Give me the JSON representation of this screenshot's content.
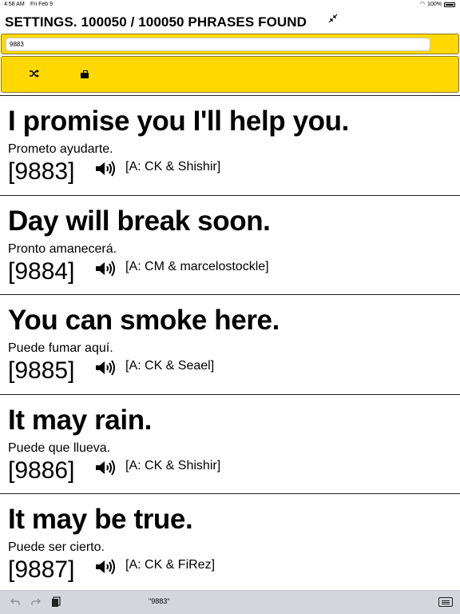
{
  "status": {
    "time": "4:58 AM",
    "date": "Fri Feb 9",
    "battery": "100%"
  },
  "header": {
    "title": "SETTINGS. 100050 / 100050 PHRASES FOUND"
  },
  "search": {
    "value": "9883"
  },
  "phrases": [
    {
      "en": "I promise you I'll help you.",
      "es": "Prometo ayudarte.",
      "id": "[9883]",
      "attrib": "[A: CK & Shishir]"
    },
    {
      "en": "Day will break soon.",
      "es": "Pronto amanecerá.",
      "id": "[9884]",
      "attrib": "[A: CM & marcelostockle]"
    },
    {
      "en": "You can smoke here.",
      "es": "Puede fumar aquí.",
      "id": "[9885]",
      "attrib": "[A: CK & Seael]"
    },
    {
      "en": "It may rain.",
      "es": "Puede que llueva.",
      "id": "[9886]",
      "attrib": "[A: CK & Shishir]"
    },
    {
      "en": "It may be true.",
      "es": "Puede ser cierto.",
      "id": "[9887]",
      "attrib": "[A: CK & FiRez]"
    }
  ],
  "keyboard_bar": {
    "suggestion": "\"9883\""
  },
  "colors": {
    "accent_panel": "#ffd800",
    "keyboard_bar": "#d4d6dc"
  },
  "icons": {
    "collapse": "collapse-arrows-icon",
    "shuffle": "shuffle-icon",
    "briefcase": "briefcase-icon",
    "speaker": "speaker-icon",
    "undo": "undo-icon",
    "redo": "redo-icon",
    "paste": "paste-icon",
    "keyboard": "keyboard-icon"
  }
}
